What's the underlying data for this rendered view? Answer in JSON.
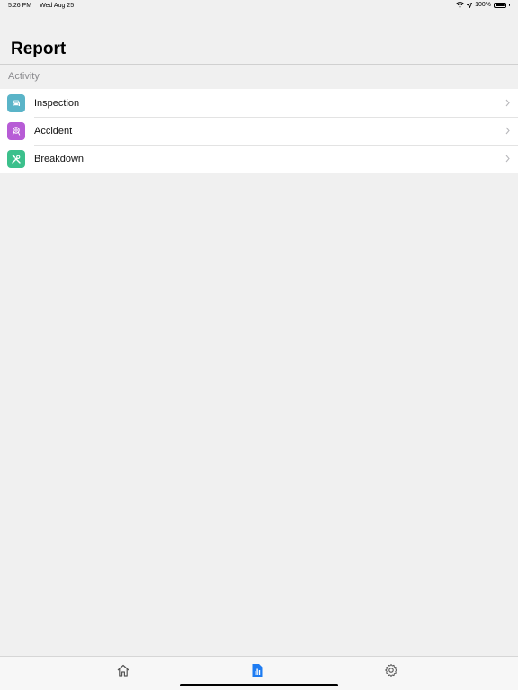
{
  "status_bar": {
    "time": "5:26 PM",
    "date": "Wed Aug 25",
    "battery": "100%",
    "wifi_icon": "wifi-icon",
    "location_icon": "location-arrow-icon",
    "battery_icon": "battery-icon"
  },
  "header": {
    "title": "Report"
  },
  "section": {
    "label": "Activity"
  },
  "list": {
    "items": [
      {
        "label": "Inspection",
        "icon": "car-icon",
        "icon_color": "#5ab4c8"
      },
      {
        "label": "Accident",
        "icon": "accident-icon",
        "icon_color": "#b75cd6"
      },
      {
        "label": "Breakdown",
        "icon": "tools-icon",
        "icon_color": "#3cc08c"
      }
    ]
  },
  "tab_bar": {
    "items": [
      {
        "icon": "home-icon",
        "active": false
      },
      {
        "icon": "report-icon",
        "active": true
      },
      {
        "icon": "gear-icon",
        "active": false
      }
    ],
    "active_color": "#1e7cf2",
    "inactive_color": "#555555"
  }
}
